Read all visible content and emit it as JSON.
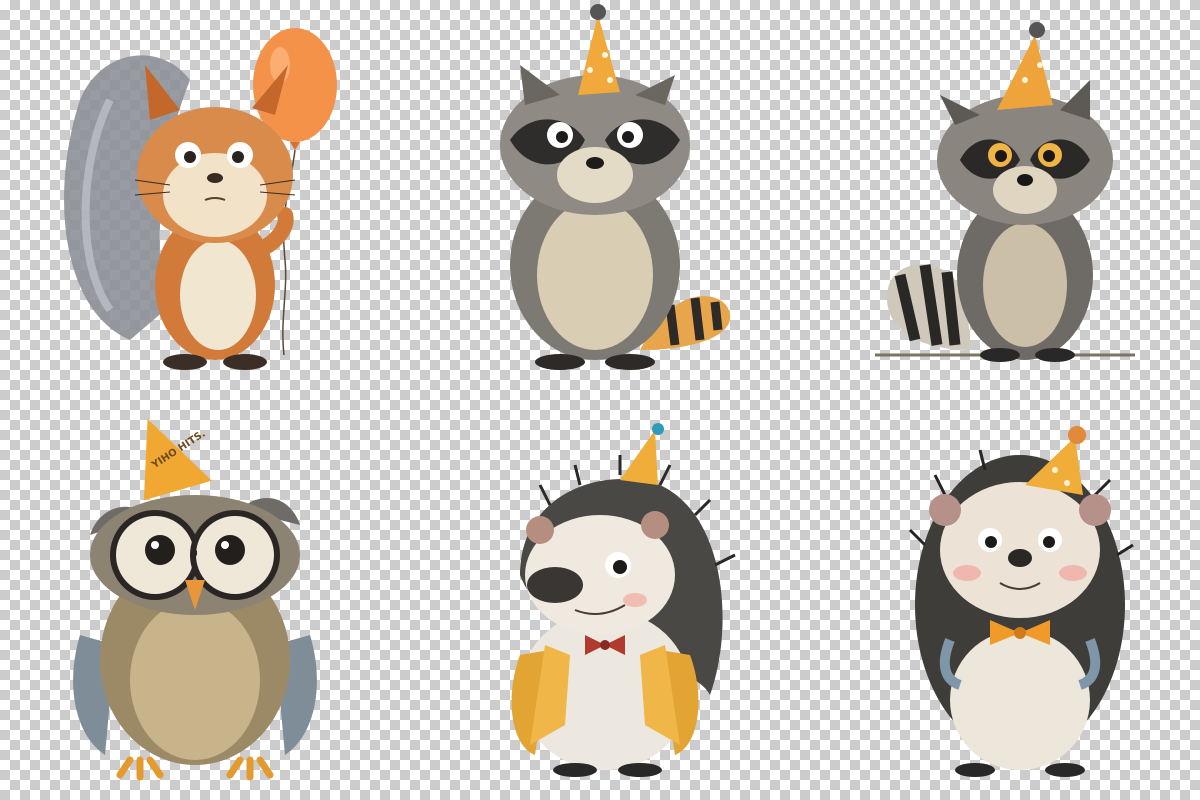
{
  "illustrations": [
    {
      "subject": "squirrel",
      "accessory": "balloon",
      "balloon_color": "#f4924a"
    },
    {
      "subject": "raccoon",
      "accessory": "party-hat",
      "hat_color": "#f0a93a"
    },
    {
      "subject": "raccoon",
      "accessory": "party-hat",
      "hat_color": "#eea43a"
    },
    {
      "subject": "owl",
      "accessory": "party-hat",
      "hat_color": "#f0a832",
      "hat_text": "YIHO HITS."
    },
    {
      "subject": "hedgehog",
      "accessory": "party-hat-and-bowtie",
      "hat_color": "#f0ad3a",
      "bowtie_color": "#b03a2e"
    },
    {
      "subject": "hedgehog",
      "accessory": "party-hat-and-bowtie",
      "hat_color": "#f0ad3a",
      "bowtie_color": "#f09a2a"
    }
  ],
  "colors": {
    "checker_light": "#ffffff",
    "checker_dark": "#cccccc"
  }
}
